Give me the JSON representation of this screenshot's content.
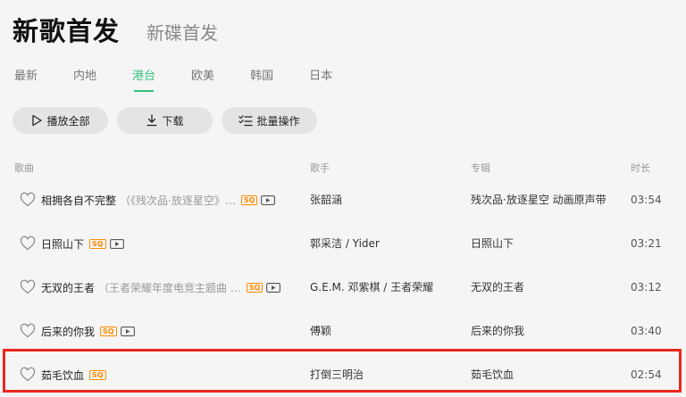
{
  "header": {
    "title": "新歌首发",
    "subtitle": "新碟首发"
  },
  "tabs": [
    {
      "label": "最新"
    },
    {
      "label": "内地"
    },
    {
      "label": "港台"
    },
    {
      "label": "欧美"
    },
    {
      "label": "韩国"
    },
    {
      "label": "日本"
    }
  ],
  "active_tab": "港台",
  "actions": {
    "play_all": "播放全部",
    "download": "下载",
    "batch": "批量操作"
  },
  "columns": {
    "song": "歌曲",
    "artist": "歌手",
    "album": "专辑",
    "duration": "时长"
  },
  "songs": [
    {
      "title": "相拥各自不完整",
      "note": "（《残次品·放逐星空》…",
      "sq": "SQ",
      "artist": "张韶涵",
      "album": "残次品·放逐星空 动画原声带",
      "duration": "03:54"
    },
    {
      "title": "日照山下",
      "note": "",
      "sq": "SQ",
      "artist": "郭采洁 / Yider",
      "album": "日照山下",
      "duration": "03:21"
    },
    {
      "title": "无双的王者",
      "note": "（王者荣耀年度电竞主题曲 …",
      "sq": "SQ",
      "artist": "G.E.M. 邓紫棋 / 王者荣耀",
      "album": "无双的王者",
      "duration": "03:12"
    },
    {
      "title": "后来的你我",
      "note": "",
      "sq": "SQ",
      "artist": "傅颖",
      "album": "后来的你我",
      "duration": "03:40"
    },
    {
      "title": "茹毛饮血",
      "note": "",
      "sq": "SQ",
      "artist": "打倒三明治",
      "album": "茹毛饮血",
      "duration": "02:54"
    }
  ],
  "colors": {
    "accent": "#31c27c",
    "sq_badge": "#ff8a00",
    "highlight": "#e8281c"
  }
}
